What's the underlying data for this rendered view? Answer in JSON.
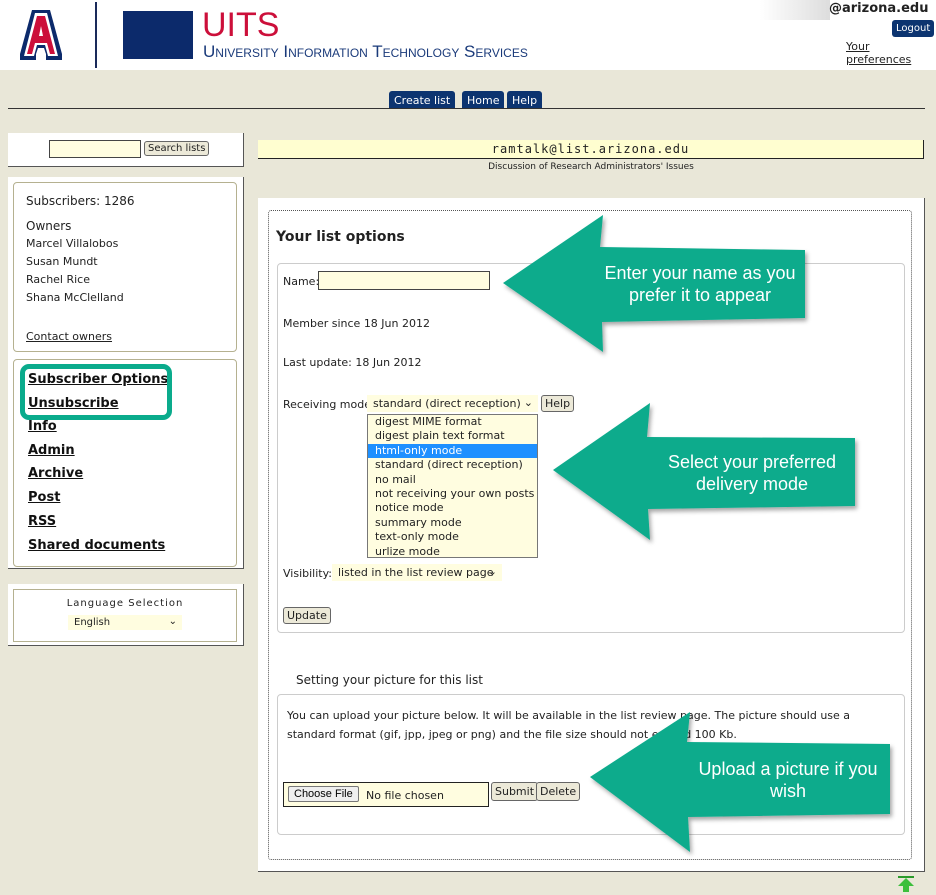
{
  "header": {
    "logo_text": "A",
    "uits_title": "UITS",
    "uits_subtitle": "University Information Technology Services",
    "user_email": "@arizona.edu",
    "logout_label": "Logout",
    "preferences_label": "Your preferences"
  },
  "tabs": [
    {
      "label": "Create list"
    },
    {
      "label": "Home"
    },
    {
      "label": "Help"
    }
  ],
  "sidebar": {
    "search_button": "Search lists",
    "search_value": "",
    "subscribers": "Subscribers: 1286",
    "owners_heading": "Owners",
    "owners": [
      "Marcel Villalobos",
      "Susan Mundt",
      "Rachel Rice",
      "Shana McClelland"
    ],
    "contact_owners": "Contact owners",
    "nav": [
      {
        "label": "Subscriber Options"
      },
      {
        "label": "Unsubscribe"
      },
      {
        "label": "Info"
      },
      {
        "label": "Admin"
      },
      {
        "label": "Archive"
      },
      {
        "label": "Post"
      },
      {
        "label": "RSS"
      },
      {
        "label": "Shared documents"
      }
    ],
    "language_heading": "Language Selection",
    "language_value": "English"
  },
  "list": {
    "address": "ramtalk@list.arizona.edu",
    "description": "Discussion of Research Administrators' Issues"
  },
  "options": {
    "title": "Your list options",
    "name_label": "Name:",
    "name_value": "",
    "member_since": "Member since 18 Jun 2012",
    "last_update": "Last update: 18 Jun 2012",
    "receiving_label": "Receiving mode:",
    "receiving_value": "standard (direct reception)",
    "help_button": "Help",
    "receiving_options": [
      "digest MIME format",
      "digest plain text format",
      "html-only mode",
      "standard (direct reception)",
      "no mail",
      "not receiving your own posts",
      "notice mode",
      "summary mode",
      "text-only mode",
      "urlize mode"
    ],
    "highlighted_option": "html-only mode",
    "visibility_label": "Visibility:",
    "visibility_value": "listed in the list review page",
    "update_button": "Update"
  },
  "picture": {
    "title": "Setting your picture for this list",
    "text": "You can upload your picture below. It will be available in the list review page. The picture should use a standard format (gif, jpp, jpeg or png) and the file size should not exceed 100 Kb.",
    "choose_file": "Choose File",
    "no_file": "No file chosen",
    "submit": "Submit",
    "delete": "Delete"
  },
  "callouts": {
    "name": "Enter your name as you prefer it to appear",
    "mode": "Select your preferred delivery mode",
    "picture": "Upload a picture if you wish",
    "color": "#0aab8c"
  }
}
